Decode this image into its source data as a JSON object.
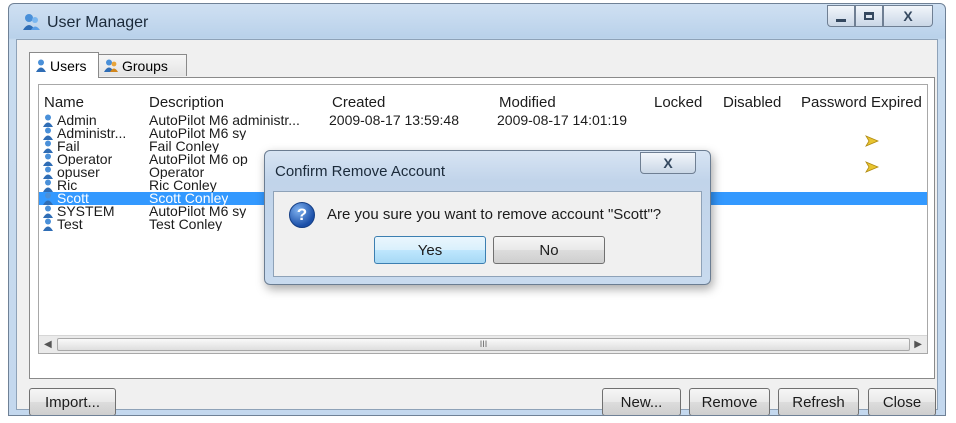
{
  "window": {
    "title": "User Manager",
    "close_glyph": "X"
  },
  "tabs": [
    {
      "label": "Users"
    },
    {
      "label": "Groups"
    }
  ],
  "columns": [
    "Name",
    "Description",
    "Created",
    "Modified",
    "Locked",
    "Disabled",
    "Password Expired"
  ],
  "rows": [
    {
      "name": "Admin",
      "description": "AutoPilot M6 administr...",
      "created": "2009-08-17 13:59:48",
      "modified": "2009-08-17 14:01:19",
      "pwd_expired": false
    },
    {
      "name": "Administr...",
      "description": "AutoPilot M6 sy",
      "created": "",
      "modified": "",
      "pwd_expired": true
    },
    {
      "name": "Fail",
      "description": "Fail Conley",
      "created": "",
      "modified": "",
      "pwd_expired": false
    },
    {
      "name": "Operator",
      "description": "AutoPilot M6 op",
      "created": "",
      "modified": "",
      "pwd_expired": true
    },
    {
      "name": "opuser",
      "description": "Operator",
      "created": "",
      "modified": "",
      "pwd_expired": false
    },
    {
      "name": "Ric",
      "description": "Ric Conley",
      "created": "",
      "modified": "",
      "pwd_expired": false
    },
    {
      "name": "Scott",
      "description": "Scott Conley",
      "created": "",
      "modified": "",
      "pwd_expired": false,
      "selected": true
    },
    {
      "name": "SYSTEM",
      "description": "AutoPilot M6 sy",
      "created": "",
      "modified": "",
      "pwd_expired": false
    },
    {
      "name": "Test",
      "description": "Test Conley",
      "created": "",
      "modified": "",
      "pwd_expired": false
    }
  ],
  "scrollbar": {
    "grip": "III"
  },
  "buttons": {
    "import": "Import...",
    "new": "New...",
    "remove": "Remove",
    "refresh": "Refresh",
    "close": "Close"
  },
  "dialog": {
    "title": "Confirm Remove Account",
    "close_glyph": "X",
    "icon": "question-icon",
    "message": "Are you sure you want to remove account \"Scott\"?",
    "yes": "Yes",
    "no": "No"
  },
  "colors": {
    "selection": "#3399ff",
    "titlebar": "#b9d1ea",
    "warning_arrow": "#e8c430"
  }
}
